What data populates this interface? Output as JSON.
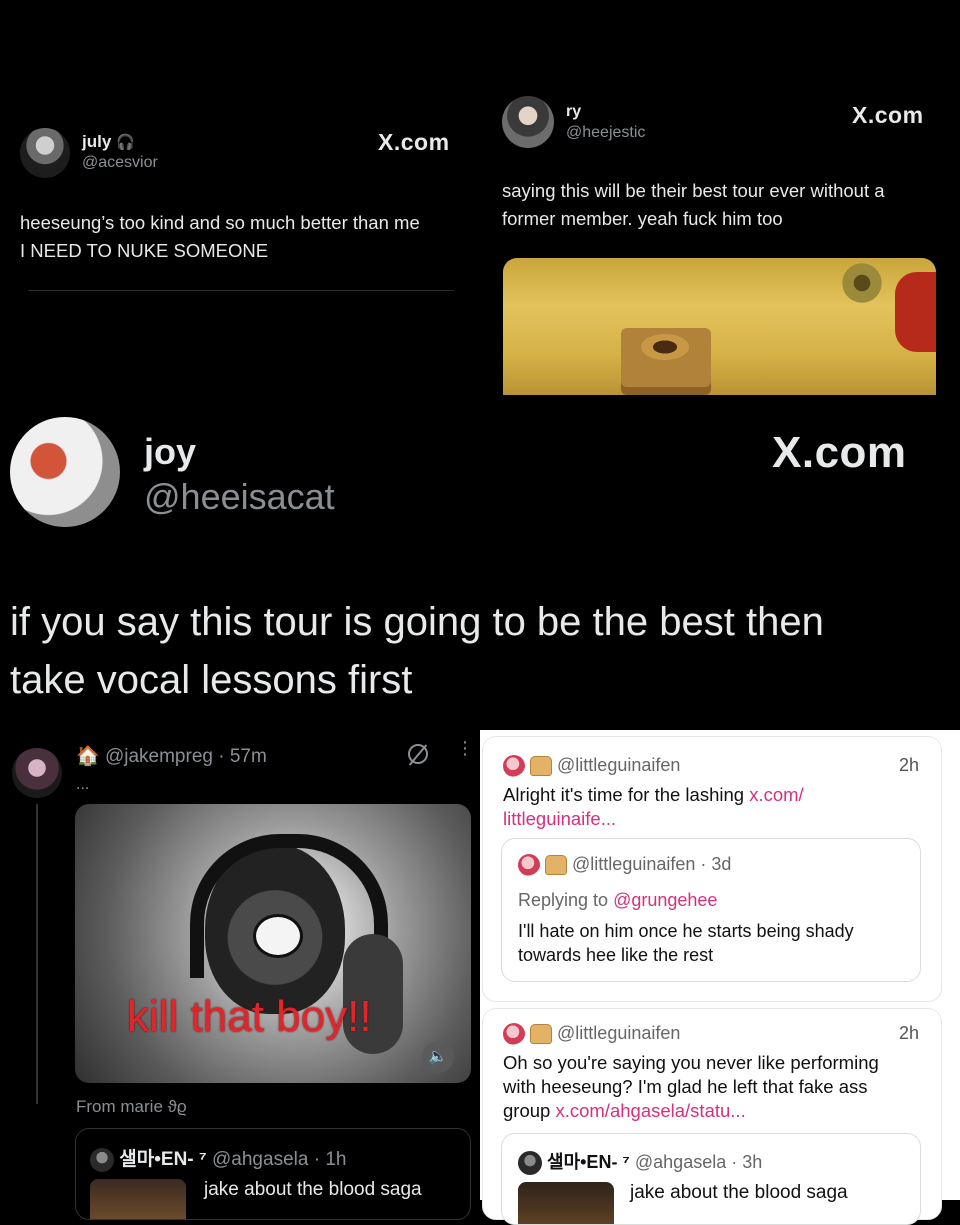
{
  "tweet1": {
    "name": "july",
    "name_icon": "headphones-icon",
    "handle": "@acesvior",
    "logo": "X.com",
    "text_line1": "heeseung’s too kind and so much better than me",
    "text_line2": "I NEED TO NUKE SOMEONE"
  },
  "tweet2": {
    "name": "ry",
    "handle": "@heejestic",
    "logo": "X.com",
    "text_line1": "saying this will be their best tour ever without a",
    "text_line2": "former member. yeah fuck him too"
  },
  "tweet3": {
    "name": "joy",
    "handle": "@heeisacat",
    "logo": "X.com",
    "text_line1": "if you say this tour is going to be the best then",
    "text_line2": "take vocal lessons first"
  },
  "tweet4": {
    "badge_icon": "house-icon",
    "handle": "@jakempreg",
    "time": "· 57m",
    "ellipsis": "...",
    "media_caption": "kill that boy!!",
    "from_line": "From marie ϑϱ",
    "quote_name": "샐마•EN- ⁷",
    "quote_handle": "@ahgasela",
    "quote_time": "· 1h",
    "quote_text": "jake about the blood saga"
  },
  "light_card1": {
    "handle": "@littleguinaifen",
    "time": "2h",
    "text": "Alright it's time for the lashing ",
    "link1": "x.com/",
    "link2": "littleguinaife...",
    "quote_handle": "@littleguinaifen",
    "quote_time": "· 3d",
    "replying_prefix": "Replying to ",
    "replying_handle": "@grungehee",
    "quote_line1": "I'll hate on him once he starts being shady",
    "quote_line2": "towards hee like the rest"
  },
  "light_card2": {
    "handle": "@littleguinaifen",
    "time": "2h",
    "line1": "Oh so you're saying you never like performing",
    "line2": "with heeseung? I'm glad he left that fake ass",
    "line3": "group ",
    "link": "x.com/ahgasela/statu...",
    "quote_name": "샐마•EN- ⁷",
    "quote_handle": "@ahgasela",
    "quote_time": "· 3h",
    "quote_text": "jake about the blood saga"
  },
  "colors": {
    "background": "#000000",
    "link_pink": "#d6307d",
    "caption_red": "#e0262d"
  }
}
